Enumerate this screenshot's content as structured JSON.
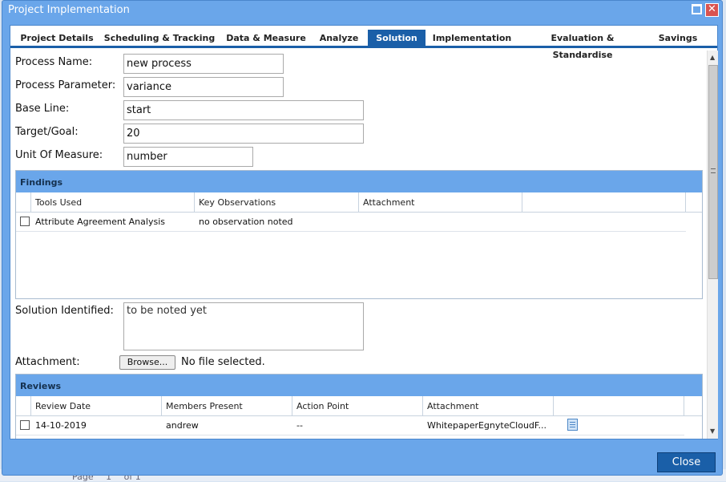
{
  "window": {
    "title": "Project Implementation",
    "close_symbol": "✕",
    "footer_close_label": "Close"
  },
  "tabs": [
    {
      "label": "Project Details"
    },
    {
      "label": "Scheduling & Tracking"
    },
    {
      "label": "Data & Measure"
    },
    {
      "label": "Analyze"
    },
    {
      "label": "Solution"
    },
    {
      "label": "Implementation"
    },
    {
      "label": "Evaluation & Standardise"
    },
    {
      "label": "Savings"
    }
  ],
  "active_tab": "Solution",
  "form": {
    "process_name": {
      "label": "Process Name:",
      "value": "new process"
    },
    "process_parameter": {
      "label": "Process Parameter:",
      "value": "variance"
    },
    "base_line": {
      "label": "Base Line:",
      "value": "start"
    },
    "target_goal": {
      "label": "Target/Goal:",
      "value": "20"
    },
    "unit_of_measure": {
      "label": "Unit Of Measure:",
      "value": "number"
    },
    "solution_identified": {
      "label": "Solution Identified:",
      "value": "to be noted yet"
    },
    "attachment": {
      "label": "Attachment:",
      "browse_label": "Browse...",
      "file_status": "No file selected."
    }
  },
  "findings": {
    "title": "Findings",
    "columns": [
      "Tools Used",
      "Key Observations",
      "Attachment"
    ],
    "rows": [
      {
        "tool": "Attribute Agreement Analysis",
        "observation": "no observation noted",
        "attachment": ""
      }
    ]
  },
  "reviews": {
    "title": "Reviews",
    "columns": [
      "Review Date",
      "Members Present",
      "Action Point",
      "Attachment"
    ],
    "rows": [
      {
        "date": "14-10-2019",
        "members": "andrew",
        "action": "--",
        "attachment": "WhitepaperEgnyteCloudF..."
      }
    ]
  },
  "background": {
    "pager_label": "Page",
    "pager_current": "1",
    "pager_of": "of 1"
  },
  "colors": {
    "window_frame": "#6aa6ea",
    "accent": "#1a5fa8",
    "close_red": "#d9534f"
  },
  "icons": {
    "maximize": "maximize-icon",
    "close": "close-icon",
    "attachment": "document-icon",
    "scroll_up": "chevron-up-icon",
    "scroll_down": "chevron-down-icon"
  }
}
